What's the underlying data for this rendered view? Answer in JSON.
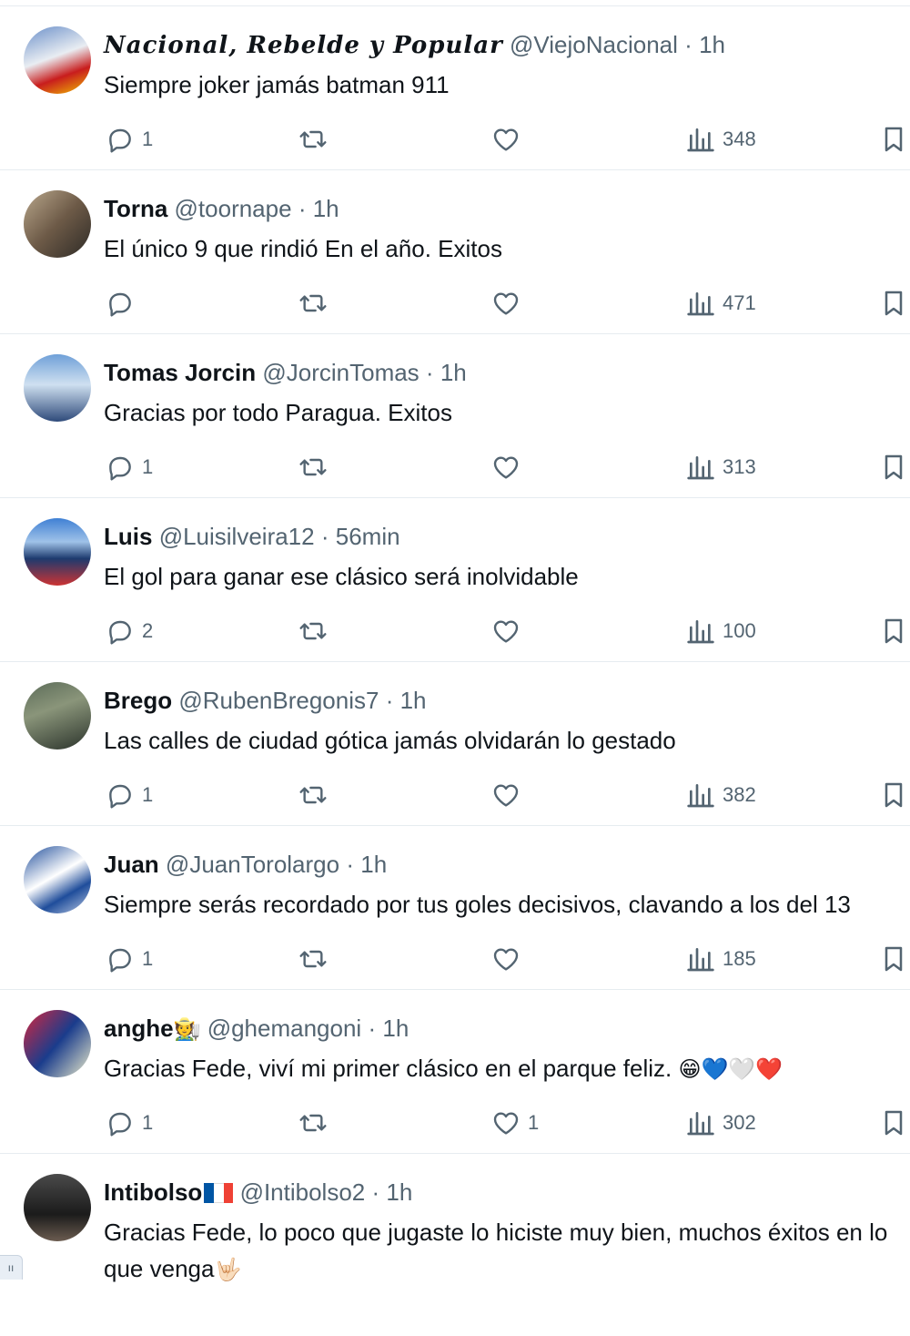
{
  "tweets": [
    {
      "name": "Nacional, Rebelde y Popular",
      "handle": "@ViejoNacional",
      "sep": "·",
      "time": "1h",
      "text": "Siempre joker jamás batman 911",
      "replies": "1",
      "retweets": "",
      "likes": "",
      "views": "348"
    },
    {
      "name": "Torna",
      "handle": "@toornape",
      "sep": "·",
      "time": "1h",
      "text": "El único 9 que rindió En el año. Exitos",
      "replies": "",
      "retweets": "",
      "likes": "",
      "views": "471"
    },
    {
      "name": "Tomas Jorcin",
      "handle": "@JorcinTomas",
      "sep": "·",
      "time": "1h",
      "text": "Gracias por todo Paragua. Exitos",
      "replies": "1",
      "retweets": "",
      "likes": "",
      "views": "313"
    },
    {
      "name": "Luis",
      "handle": "@Luisilveira12",
      "sep": "·",
      "time": "56min",
      "text": "El gol para ganar ese clásico será inolvidable",
      "replies": "2",
      "retweets": "",
      "likes": "",
      "views": "100"
    },
    {
      "name": "Brego",
      "handle": "@RubenBregonis7",
      "sep": "·",
      "time": "1h",
      "text": "Las calles de ciudad gótica jamás olvidarán lo gestado",
      "replies": "1",
      "retweets": "",
      "likes": "",
      "views": "382"
    },
    {
      "name": "Juan",
      "handle": "@JuanTorolargo",
      "sep": "·",
      "time": "1h",
      "text": "Siempre serás recordado por tus goles decisivos, clavando a los del 13",
      "replies": "1",
      "retweets": "",
      "likes": "",
      "views": "185"
    },
    {
      "name": "anghe",
      "name_emoji": "🧑‍🌾",
      "handle": "@ghemangoni",
      "sep": "·",
      "time": "1h",
      "text": "Gracias Fede, viví mi primer clásico en el parque feliz.",
      "text_emoji": "😁💙🤍❤️",
      "replies": "1",
      "retweets": "",
      "likes": "1",
      "views": "302"
    },
    {
      "name": "Intibolso",
      "name_flag": "france-flag",
      "handle": "@Intibolso2",
      "sep": "·",
      "time": "1h",
      "text": "Gracias Fede, lo poco que jugaste lo hiciste muy bien, muchos éxitos en lo que venga",
      "text_emoji": "🤟🏻"
    }
  ],
  "colors": {
    "text": "#0f1419",
    "secondary": "#536471",
    "divider": "#e6ecf0",
    "flag_blue": "#0055a4",
    "flag_white": "#ffffff",
    "flag_red": "#ef4135"
  },
  "icons": {
    "reply": "reply-icon",
    "retweet": "retweet-icon",
    "like": "heart-icon",
    "views": "views-chart-icon",
    "bookmark": "bookmark-icon"
  }
}
